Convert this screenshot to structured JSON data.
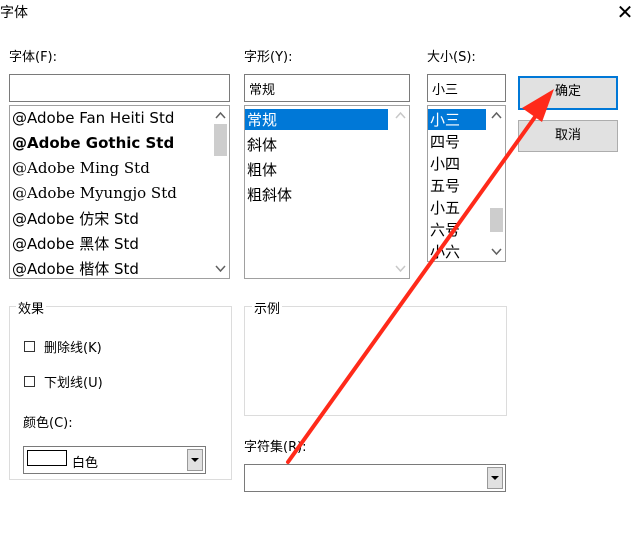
{
  "window": {
    "title": "字体",
    "close_glyph": "✕"
  },
  "font": {
    "label": "字体(F):",
    "value": "",
    "items": [
      "@Adobe Fan Heiti Std",
      "@Adobe Gothic Std",
      "@Adobe Ming Std",
      "@Adobe Myungjo Std",
      "@Adobe 仿宋 Std",
      "@Adobe 黑体 Std",
      "@Adobe 楷体 Std"
    ]
  },
  "style": {
    "label": "字形(Y):",
    "value": "常规",
    "items": [
      "常规",
      "斜体",
      "粗体",
      "粗斜体"
    ],
    "selected": "常规"
  },
  "size": {
    "label": "大小(S):",
    "value": "小三",
    "items": [
      "小三",
      "四号",
      "小四",
      "五号",
      "小五",
      "六号",
      "小六"
    ],
    "selected": "小三"
  },
  "buttons": {
    "ok": "确定",
    "cancel": "取消"
  },
  "effects": {
    "label": "效果",
    "strikeout": "删除线(K)",
    "underline": "下划线(U)",
    "color_label": "颜色(C):",
    "color_value": "白色"
  },
  "sample": {
    "label": "示例"
  },
  "charset": {
    "label": "字符集(R):",
    "value": ""
  },
  "colors": {
    "annotation_arrow": "#ff2a1a",
    "selection": "#0078d7"
  }
}
